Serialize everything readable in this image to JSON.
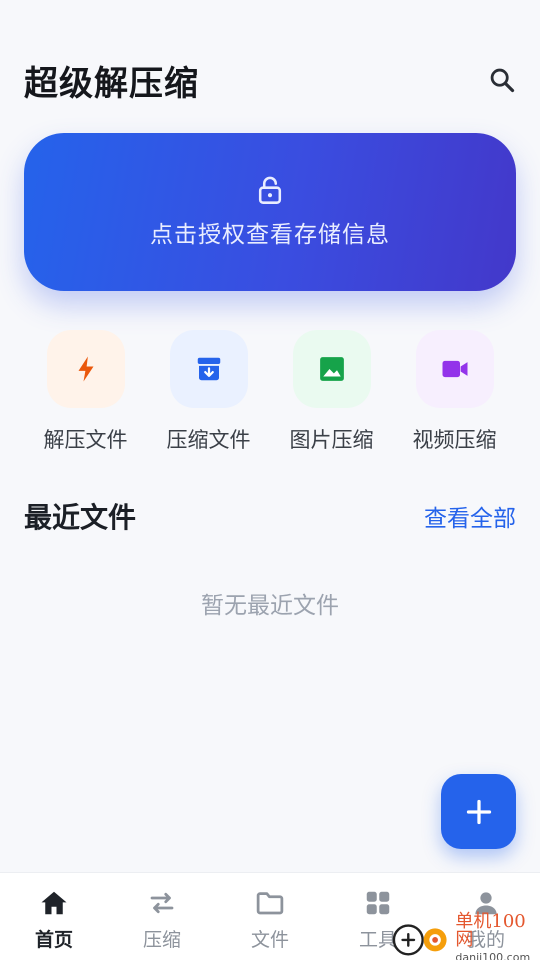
{
  "header": {
    "title": "超级解压缩",
    "search_icon": "search-icon"
  },
  "banner": {
    "icon": "lock-open-icon",
    "text": "点击授权查看存储信息"
  },
  "shortcuts": [
    {
      "label": "解压文件",
      "icon": "bolt-icon",
      "color": "#ea580c",
      "bg": "#fff3ea"
    },
    {
      "label": "压缩文件",
      "icon": "archive-icon",
      "color": "#2563eb",
      "bg": "#eaf1ff"
    },
    {
      "label": "图片压缩",
      "icon": "image-icon",
      "color": "#16a34a",
      "bg": "#eafaf0"
    },
    {
      "label": "视频压缩",
      "icon": "video-icon",
      "color": "#9333ea",
      "bg": "#f7effe"
    }
  ],
  "recent": {
    "title": "最近文件",
    "view_all": "查看全部",
    "empty": "暂无最近文件"
  },
  "fab": {
    "icon": "plus-icon"
  },
  "tabs": [
    {
      "label": "首页",
      "icon": "home-icon",
      "active": true
    },
    {
      "label": "压缩",
      "icon": "swap-icon",
      "active": false
    },
    {
      "label": "文件",
      "icon": "folder-icon",
      "active": false
    },
    {
      "label": "工具",
      "icon": "grid-icon",
      "active": false
    },
    {
      "label": "我的",
      "icon": "person-icon",
      "active": false
    }
  ],
  "watermark": {
    "name": "单机100网",
    "url": "danji100.com"
  },
  "colors": {
    "accent": "#2563eb",
    "tab_active": "#1f2329",
    "tab_inactive": "#8d939c"
  }
}
